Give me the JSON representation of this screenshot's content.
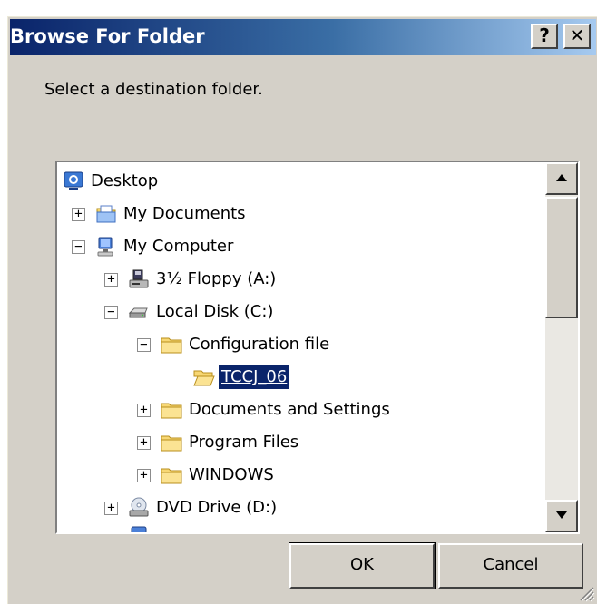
{
  "window": {
    "title": "Browse For Folder",
    "help_label": "?",
    "close_label": "✕"
  },
  "instruction": "Select a destination folder.",
  "tree": {
    "items": [
      {
        "label": "Desktop",
        "icon": "desktop-icon",
        "expander": ""
      },
      {
        "label": "My Documents",
        "icon": "documents-folder-icon",
        "expander": "+"
      },
      {
        "label": "My Computer",
        "icon": "computer-icon",
        "expander": "−"
      },
      {
        "label": "3½ Floppy (A:)",
        "icon": "floppy-drive-icon",
        "expander": "+"
      },
      {
        "label": "Local Disk (C:)",
        "icon": "hard-disk-icon",
        "expander": "−"
      },
      {
        "label": "Configuration file",
        "icon": "folder-icon",
        "expander": "−"
      },
      {
        "label": "TCCJ_06",
        "icon": "open-folder-icon",
        "expander": "",
        "selected": true
      },
      {
        "label": "Documents and Settings",
        "icon": "folder-icon",
        "expander": "+"
      },
      {
        "label": "Program Files",
        "icon": "folder-icon",
        "expander": "+"
      },
      {
        "label": "WINDOWS",
        "icon": "folder-icon",
        "expander": "+"
      },
      {
        "label": "DVD Drive (D:)",
        "icon": "dvd-drive-icon",
        "expander": "+"
      }
    ]
  },
  "buttons": {
    "ok": "OK",
    "cancel": "Cancel"
  },
  "colors": {
    "title_start": "#0a246a",
    "title_end": "#a6caf0",
    "face": "#d4d0c8",
    "selection": "#0a246a"
  }
}
